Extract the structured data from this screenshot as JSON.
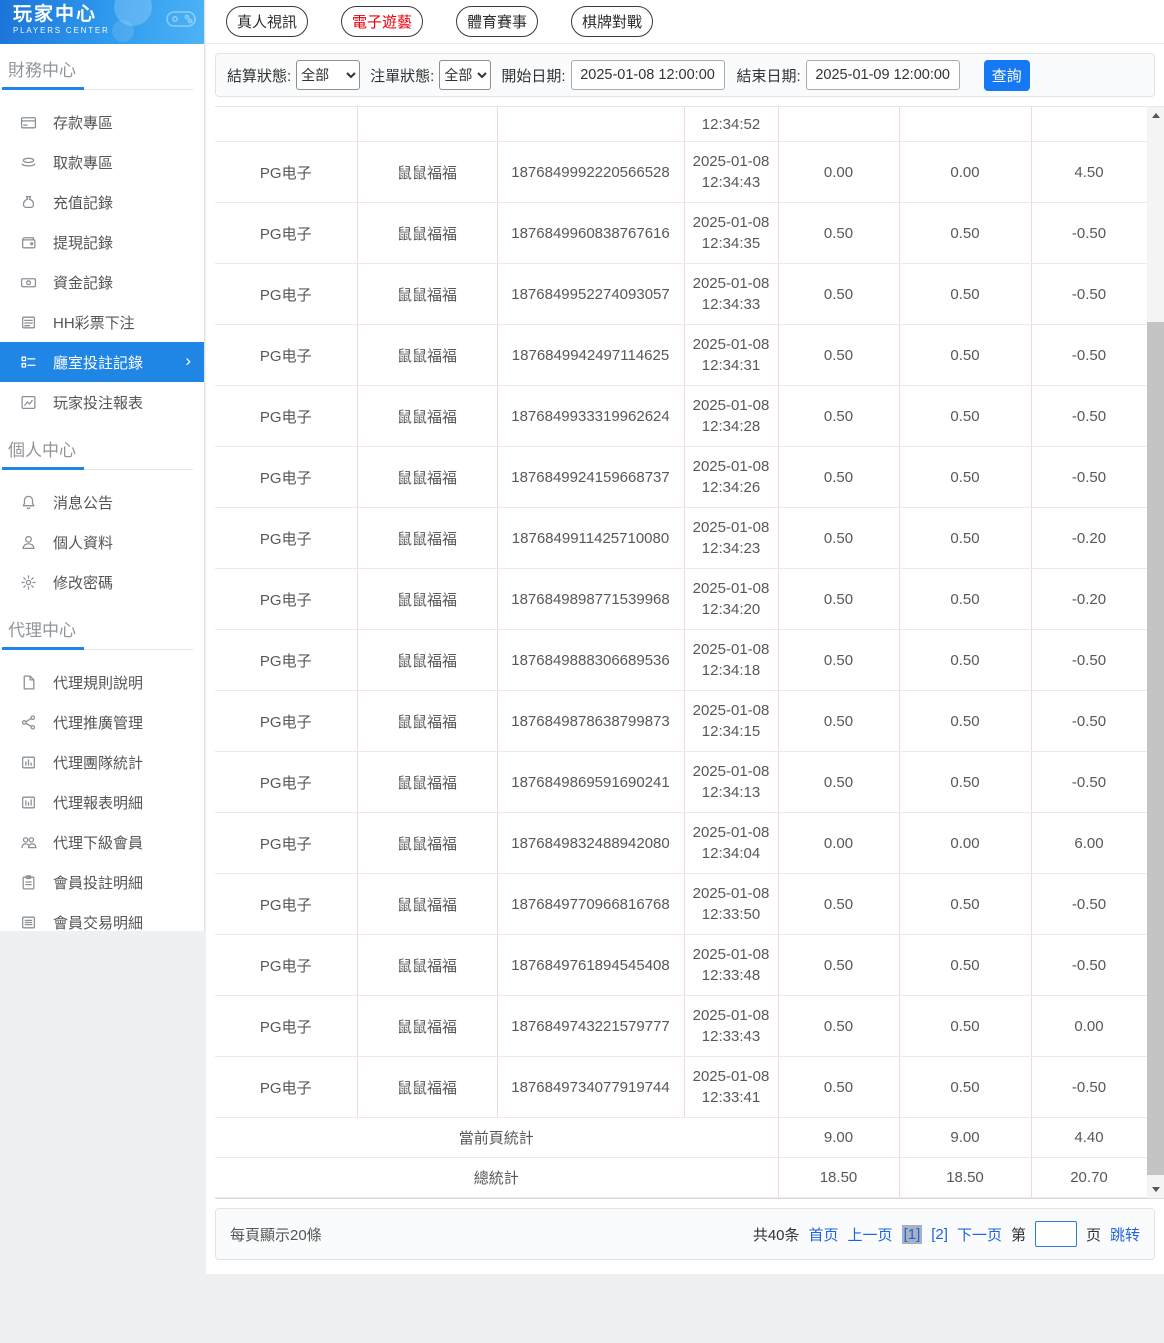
{
  "brand": {
    "title": "玩家中心",
    "subtitle": "PLAYERS CENTER"
  },
  "sidebar": {
    "sections": [
      {
        "title": "財務中心",
        "items": [
          {
            "icon": "deposit-card-icon",
            "label": "存款專區"
          },
          {
            "icon": "withdraw-hand-icon",
            "label": "取款專區"
          },
          {
            "icon": "recharge-bag-icon",
            "label": "充值記錄"
          },
          {
            "icon": "withdraw-record-icon",
            "label": "提現記錄"
          },
          {
            "icon": "funds-record-icon",
            "label": "資金記錄"
          },
          {
            "icon": "lottery-doc-icon",
            "label": "HH彩票下注"
          },
          {
            "icon": "room-bet-list-icon",
            "label": "廳室投註記錄",
            "active": true,
            "chevron": "›"
          },
          {
            "icon": "player-report-icon",
            "label": "玩家投注報表"
          }
        ]
      },
      {
        "title": "個人中心",
        "items": [
          {
            "icon": "bell-icon",
            "label": "消息公告"
          },
          {
            "icon": "user-icon",
            "label": "個人資料"
          },
          {
            "icon": "gear-icon",
            "label": "修改密碼"
          }
        ]
      },
      {
        "title": "代理中心",
        "items": [
          {
            "icon": "rules-doc-icon",
            "label": "代理規則說明"
          },
          {
            "icon": "share-icon",
            "label": "代理推廣管理"
          },
          {
            "icon": "team-stats-icon",
            "label": "代理團隊統計"
          },
          {
            "icon": "report-detail-icon",
            "label": "代理報表明細"
          },
          {
            "icon": "members-icon",
            "label": "代理下級會員"
          },
          {
            "icon": "member-bet-icon",
            "label": "會員投註明細"
          },
          {
            "icon": "member-trade-icon",
            "label": "會員交易明細"
          }
        ]
      }
    ]
  },
  "tabs": [
    {
      "label": "真人視訊",
      "active": false
    },
    {
      "label": "電子遊藝",
      "active": true
    },
    {
      "label": "體育賽事",
      "active": false
    },
    {
      "label": "棋牌對戰",
      "active": false
    }
  ],
  "filters": {
    "settle_label": "結算狀態:",
    "settle_value": "全部",
    "order_label": "注單狀態:",
    "order_value": "全部",
    "start_label": "開始日期:",
    "start_value": "2025-01-08 12:00:00",
    "end_label": "結束日期:",
    "end_value": "2025-01-09 12:00:00",
    "query_label": "查詢"
  },
  "table": {
    "partial_first_row_time": "12:34:52",
    "rows": [
      {
        "platform": "PG电子",
        "game": "鼠鼠福福",
        "order_id": "1876849992220566528",
        "date": "2025-01-08",
        "time": "12:34:43",
        "bet": "0.00",
        "valid_bet": "0.00",
        "profit": "4.50"
      },
      {
        "platform": "PG电子",
        "game": "鼠鼠福福",
        "order_id": "1876849960838767616",
        "date": "2025-01-08",
        "time": "12:34:35",
        "bet": "0.50",
        "valid_bet": "0.50",
        "profit": "-0.50"
      },
      {
        "platform": "PG电子",
        "game": "鼠鼠福福",
        "order_id": "1876849952274093057",
        "date": "2025-01-08",
        "time": "12:34:33",
        "bet": "0.50",
        "valid_bet": "0.50",
        "profit": "-0.50"
      },
      {
        "platform": "PG电子",
        "game": "鼠鼠福福",
        "order_id": "1876849942497114625",
        "date": "2025-01-08",
        "time": "12:34:31",
        "bet": "0.50",
        "valid_bet": "0.50",
        "profit": "-0.50"
      },
      {
        "platform": "PG电子",
        "game": "鼠鼠福福",
        "order_id": "1876849933319962624",
        "date": "2025-01-08",
        "time": "12:34:28",
        "bet": "0.50",
        "valid_bet": "0.50",
        "profit": "-0.50"
      },
      {
        "platform": "PG电子",
        "game": "鼠鼠福福",
        "order_id": "1876849924159668737",
        "date": "2025-01-08",
        "time": "12:34:26",
        "bet": "0.50",
        "valid_bet": "0.50",
        "profit": "-0.50"
      },
      {
        "platform": "PG电子",
        "game": "鼠鼠福福",
        "order_id": "1876849911425710080",
        "date": "2025-01-08",
        "time": "12:34:23",
        "bet": "0.50",
        "valid_bet": "0.50",
        "profit": "-0.20"
      },
      {
        "platform": "PG电子",
        "game": "鼠鼠福福",
        "order_id": "1876849898771539968",
        "date": "2025-01-08",
        "time": "12:34:20",
        "bet": "0.50",
        "valid_bet": "0.50",
        "profit": "-0.20"
      },
      {
        "platform": "PG电子",
        "game": "鼠鼠福福",
        "order_id": "1876849888306689536",
        "date": "2025-01-08",
        "time": "12:34:18",
        "bet": "0.50",
        "valid_bet": "0.50",
        "profit": "-0.50"
      },
      {
        "platform": "PG电子",
        "game": "鼠鼠福福",
        "order_id": "1876849878638799873",
        "date": "2025-01-08",
        "time": "12:34:15",
        "bet": "0.50",
        "valid_bet": "0.50",
        "profit": "-0.50"
      },
      {
        "platform": "PG电子",
        "game": "鼠鼠福福",
        "order_id": "1876849869591690241",
        "date": "2025-01-08",
        "time": "12:34:13",
        "bet": "0.50",
        "valid_bet": "0.50",
        "profit": "-0.50"
      },
      {
        "platform": "PG电子",
        "game": "鼠鼠福福",
        "order_id": "1876849832488942080",
        "date": "2025-01-08",
        "time": "12:34:04",
        "bet": "0.00",
        "valid_bet": "0.00",
        "profit": "6.00"
      },
      {
        "platform": "PG电子",
        "game": "鼠鼠福福",
        "order_id": "1876849770966816768",
        "date": "2025-01-08",
        "time": "12:33:50",
        "bet": "0.50",
        "valid_bet": "0.50",
        "profit": "-0.50"
      },
      {
        "platform": "PG电子",
        "game": "鼠鼠福福",
        "order_id": "1876849761894545408",
        "date": "2025-01-08",
        "time": "12:33:48",
        "bet": "0.50",
        "valid_bet": "0.50",
        "profit": "-0.50"
      },
      {
        "platform": "PG电子",
        "game": "鼠鼠福福",
        "order_id": "1876849743221579777",
        "date": "2025-01-08",
        "time": "12:33:43",
        "bet": "0.50",
        "valid_bet": "0.50",
        "profit": "0.00"
      },
      {
        "platform": "PG电子",
        "game": "鼠鼠福福",
        "order_id": "1876849734077919744",
        "date": "2025-01-08",
        "time": "12:33:41",
        "bet": "0.50",
        "valid_bet": "0.50",
        "profit": "-0.50"
      }
    ],
    "page_summary": {
      "label": "當前頁統計",
      "values": [
        "9.00",
        "9.00",
        "4.40"
      ]
    },
    "total_summary": {
      "label": "總統計",
      "values": [
        "18.50",
        "18.50",
        "20.70"
      ]
    }
  },
  "pagination": {
    "per_page": "每頁顯示20條",
    "total_count": "共40条",
    "first": "首页",
    "prev": "上一页",
    "page1": "[1]",
    "page2": "[2]",
    "next": "下一页",
    "jump_pre": "第",
    "jump_post": "页",
    "jump": "跳转",
    "jump_value": ""
  },
  "colors": {
    "accent_blue": "#1f86e5",
    "query_button_blue": "#1678f2",
    "active_tab_red": "#e8000d",
    "link_blue": "#2064d9",
    "current_page_bg": "#a6b2c2",
    "table_border_pink": "#f0d9d9"
  }
}
